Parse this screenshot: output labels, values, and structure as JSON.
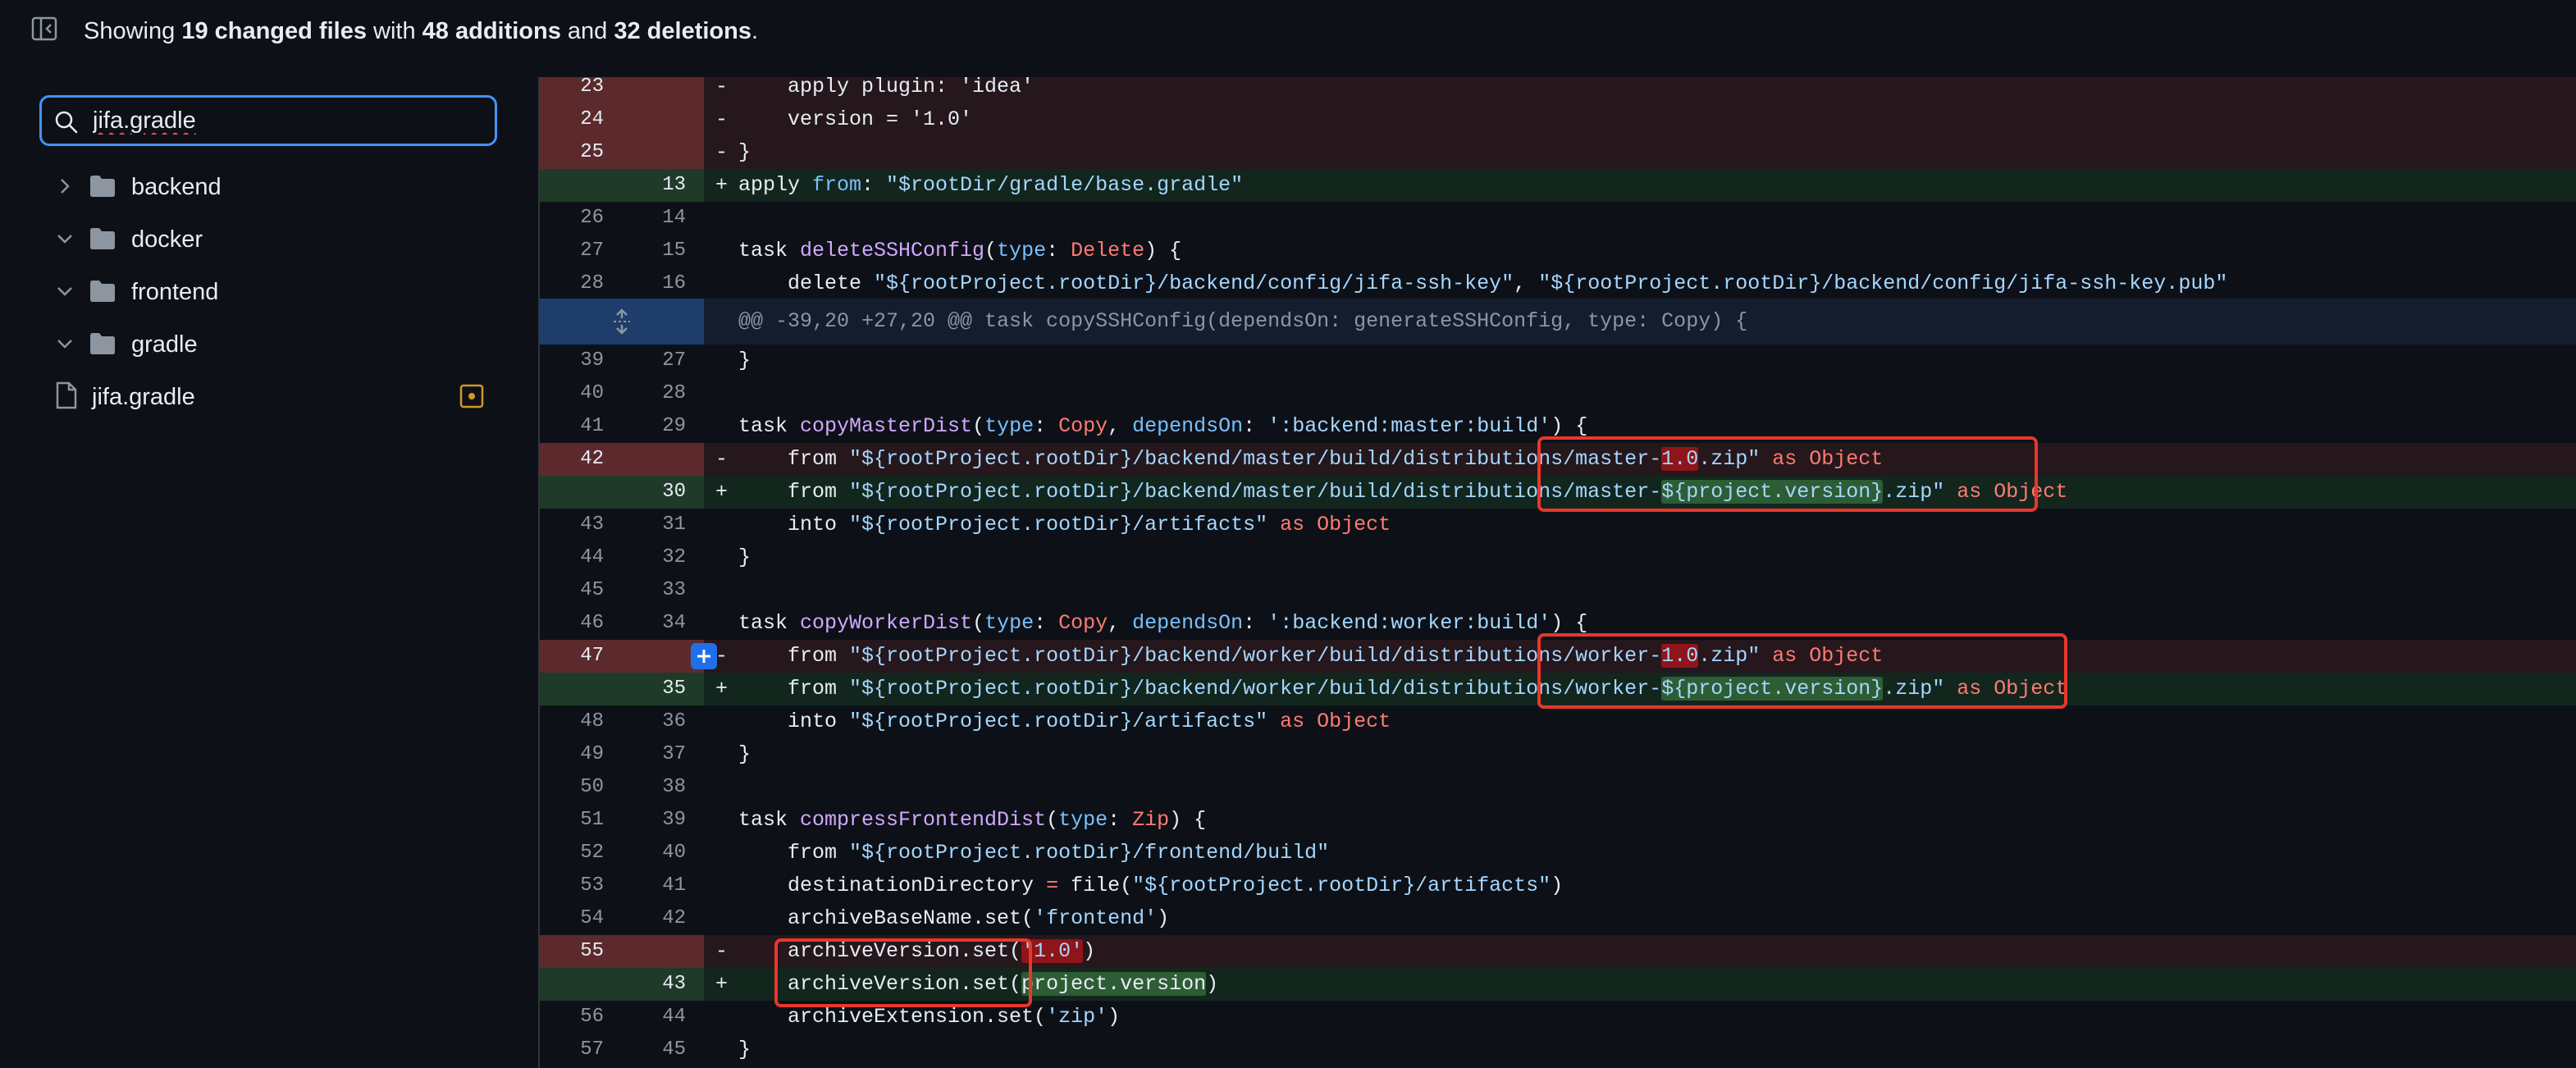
{
  "topbar": {
    "summary_prefix": "Showing ",
    "changed_files": "19 changed files",
    "with_text": " with ",
    "additions": "48 additions",
    "and_text": " and ",
    "deletions": "32 deletions",
    "period": "."
  },
  "sidebar": {
    "filter_value": "jifa.gradle",
    "tree": [
      {
        "label": "backend",
        "type": "folder",
        "expanded": false
      },
      {
        "label": "docker",
        "type": "folder",
        "expanded": true
      },
      {
        "label": "frontend",
        "type": "folder",
        "expanded": true
      },
      {
        "label": "gradle",
        "type": "folder",
        "expanded": true
      },
      {
        "label": "jifa.gradle",
        "type": "file",
        "status": "modified"
      }
    ]
  },
  "diff": {
    "hunk_header": "@@ -39,20 +27,20 @@ task copySSHConfig(dependsOn: generateSSHConfig, type: Copy) {",
    "lines": [
      {
        "old": "23",
        "new": "",
        "marker": "-",
        "type": "del"
      },
      {
        "old": "24",
        "new": "",
        "marker": "-",
        "type": "del"
      },
      {
        "old": "25",
        "new": "",
        "marker": "-",
        "type": "del"
      },
      {
        "old": "",
        "new": "13",
        "marker": "+",
        "type": "add"
      },
      {
        "old": "26",
        "new": "14",
        "marker": "",
        "type": "ctx"
      },
      {
        "old": "27",
        "new": "15",
        "marker": "",
        "type": "ctx"
      },
      {
        "old": "28",
        "new": "16",
        "marker": "",
        "type": "ctx"
      },
      {
        "old": "39",
        "new": "27",
        "marker": "",
        "type": "ctx"
      },
      {
        "old": "40",
        "new": "28",
        "marker": "",
        "type": "ctx"
      },
      {
        "old": "41",
        "new": "29",
        "marker": "",
        "type": "ctx"
      },
      {
        "old": "42",
        "new": "",
        "marker": "-",
        "type": "del"
      },
      {
        "old": "",
        "new": "30",
        "marker": "+",
        "type": "add"
      },
      {
        "old": "43",
        "new": "31",
        "marker": "",
        "type": "ctx"
      },
      {
        "old": "44",
        "new": "32",
        "marker": "",
        "type": "ctx"
      },
      {
        "old": "45",
        "new": "33",
        "marker": "",
        "type": "ctx"
      },
      {
        "old": "46",
        "new": "34",
        "marker": "",
        "type": "ctx"
      },
      {
        "old": "47",
        "new": "",
        "marker": "-",
        "type": "del"
      },
      {
        "old": "",
        "new": "35",
        "marker": "+",
        "type": "add"
      },
      {
        "old": "48",
        "new": "36",
        "marker": "",
        "type": "ctx"
      },
      {
        "old": "49",
        "new": "37",
        "marker": "",
        "type": "ctx"
      },
      {
        "old": "50",
        "new": "38",
        "marker": "",
        "type": "ctx"
      },
      {
        "old": "51",
        "new": "39",
        "marker": "",
        "type": "ctx"
      },
      {
        "old": "52",
        "new": "40",
        "marker": "",
        "type": "ctx"
      },
      {
        "old": "53",
        "new": "41",
        "marker": "",
        "type": "ctx"
      },
      {
        "old": "54",
        "new": "42",
        "marker": "",
        "type": "ctx"
      },
      {
        "old": "55",
        "new": "",
        "marker": "-",
        "type": "del"
      },
      {
        "old": "",
        "new": "43",
        "marker": "+",
        "type": "add"
      },
      {
        "old": "56",
        "new": "44",
        "marker": "",
        "type": "ctx"
      },
      {
        "old": "57",
        "new": "45",
        "marker": "",
        "type": "ctx"
      }
    ],
    "code": {
      "l23": "    apply plugin: 'idea'",
      "l24": "    version = '1.0'",
      "l25": "}",
      "n13_a": "apply ",
      "n13_b": "from",
      "n13_c": ": ",
      "n13_d": "\"$rootDir/gradle/base.gradle\"",
      "l27_a": "task ",
      "l27_b": "deleteSSHConfig",
      "l27_c": "(",
      "l27_d": "type",
      "l27_e": ": ",
      "l27_f": "Delete",
      "l27_g": ") {",
      "l28_a": "    delete ",
      "l28_b": "\"${rootProject.rootDir}/backend/config/jifa-ssh-key\"",
      "l28_c": ", ",
      "l28_d": "\"${rootProject.rootDir}/backend/config/jifa-ssh-key.pub\"",
      "l39": "}",
      "l41_a": "task ",
      "l41_b": "copyMasterDist",
      "l41_c": "(",
      "l41_d": "type",
      "l41_e": ": ",
      "l41_f": "Copy",
      "l41_g": ", ",
      "l41_h": "dependsOn",
      "l41_i": ": ",
      "l41_j": "':backend:master:build'",
      "l41_k": ") {",
      "l42_a": "    from ",
      "l42_b": "\"${rootProject.rootDir}/backend/master/build/distributions/master-",
      "l42_c": "1.0",
      "l42_d": ".zip\"",
      "l42_e": " as ",
      "l42_f": "Object",
      "n30_a": "    from ",
      "n30_b": "\"${rootProject.rootDir}/backend/master/build/distributions/master-",
      "n30_c": "${project.version}",
      "n30_d": ".zip\"",
      "n30_e": " as ",
      "n30_f": "Object",
      "l43_a": "    into ",
      "l43_b": "\"${rootProject.rootDir}/artifacts\"",
      "l43_c": " as ",
      "l43_d": "Object",
      "l44": "}",
      "l46_a": "task ",
      "l46_b": "copyWorkerDist",
      "l46_c": "(",
      "l46_d": "type",
      "l46_e": ": ",
      "l46_f": "Copy",
      "l46_g": ", ",
      "l46_h": "dependsOn",
      "l46_i": ": ",
      "l46_j": "':backend:worker:build'",
      "l46_k": ") {",
      "l47_a": "    from ",
      "l47_b": "\"${rootProject.rootDir}/backend/worker/build/distributions/worker-",
      "l47_c": "1.0",
      "l47_d": ".zip\"",
      "l47_e": " as ",
      "l47_f": "Object",
      "n35_a": "    from ",
      "n35_b": "\"${rootProject.rootDir}/backend/worker/build/distributions/worker-",
      "n35_c": "${project.version}",
      "n35_d": ".zip\"",
      "n35_e": " as ",
      "n35_f": "Object",
      "l48_a": "    into ",
      "l48_b": "\"${rootProject.rootDir}/artifacts\"",
      "l48_c": " as ",
      "l48_d": "Object",
      "l49": "}",
      "l51_a": "task ",
      "l51_b": "compressFrontendDist",
      "l51_c": "(",
      "l51_d": "type",
      "l51_e": ": ",
      "l51_f": "Zip",
      "l51_g": ") {",
      "l52_a": "    from ",
      "l52_b": "\"${rootProject.rootDir}/frontend/build\"",
      "l53_a": "    destinationDirectory ",
      "l53_b": "=",
      "l53_c": " file(",
      "l53_d": "\"${rootProject.rootDir}/artifacts\"",
      "l53_e": ")",
      "l54_a": "    archiveBaseName.set(",
      "l54_b": "'frontend'",
      "l54_c": ")",
      "l55_a": "    archiveVersion.set(",
      "l55_b": "'1.0'",
      "l55_c": ")",
      "n43_a": "    archiveVersion.set(",
      "n43_b": "project.version",
      "n43_c": ")",
      "l56_a": "    archiveExtension.set(",
      "l56_b": "'zip'",
      "l56_c": ")",
      "l57": "}"
    }
  },
  "colors": {
    "accent": "#4493f8",
    "deletion_bg": "#5c2a2d",
    "addition_bg": "#1f3a28",
    "annotation_box": "#e8372c",
    "modified_badge": "#d29922"
  }
}
